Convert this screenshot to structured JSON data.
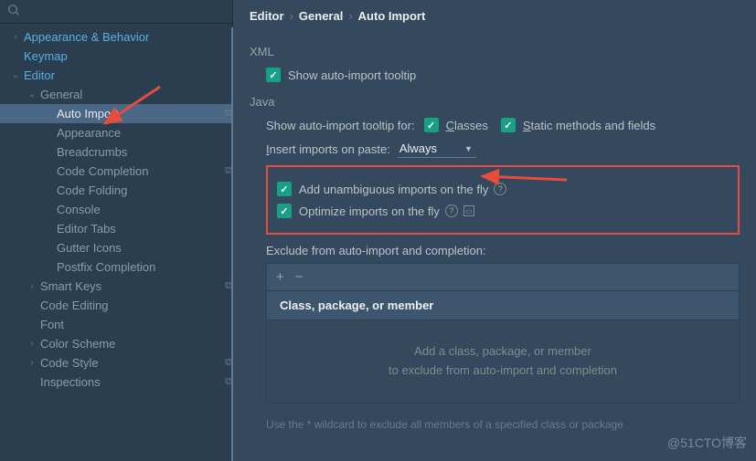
{
  "breadcrumb": {
    "a": "Editor",
    "b": "General",
    "c": "Auto Import"
  },
  "sidebar": {
    "search_placeholder": "",
    "items": [
      {
        "label": "Appearance & Behavior",
        "chev": "›",
        "hl": true
      },
      {
        "label": "Keymap",
        "chev": "",
        "hl": true
      },
      {
        "label": "Editor",
        "chev": "⌄",
        "hl": true
      },
      {
        "label": "General",
        "chev": "⌄",
        "indent": 1
      },
      {
        "label": "Auto Import",
        "chev": "",
        "indent": 2,
        "selected": true,
        "icon": "⧉"
      },
      {
        "label": "Appearance",
        "chev": "",
        "indent": 2
      },
      {
        "label": "Breadcrumbs",
        "chev": "",
        "indent": 2
      },
      {
        "label": "Code Completion",
        "chev": "",
        "indent": 2,
        "icon": "⧉"
      },
      {
        "label": "Code Folding",
        "chev": "",
        "indent": 2
      },
      {
        "label": "Console",
        "chev": "",
        "indent": 2
      },
      {
        "label": "Editor Tabs",
        "chev": "",
        "indent": 2
      },
      {
        "label": "Gutter Icons",
        "chev": "",
        "indent": 2
      },
      {
        "label": "Postfix Completion",
        "chev": "",
        "indent": 2
      },
      {
        "label": "Smart Keys",
        "chev": "›",
        "indent": 1,
        "icon": "⧉"
      },
      {
        "label": "Code Editing",
        "chev": "",
        "indent": 1
      },
      {
        "label": "Font",
        "chev": "",
        "indent": 1
      },
      {
        "label": "Color Scheme",
        "chev": "›",
        "indent": 1
      },
      {
        "label": "Code Style",
        "chev": "›",
        "indent": 1,
        "icon": "⧉"
      },
      {
        "label": "Inspections",
        "chev": "",
        "indent": 1,
        "icon": "⧉"
      }
    ]
  },
  "xml": {
    "title": "XML",
    "show_tooltip": "Show auto-import tooltip"
  },
  "java": {
    "title": "Java",
    "tooltip_for": "Show auto-import tooltip for:",
    "classes": "Classes",
    "static": "Static methods and fields",
    "insert_label": "Insert imports on paste:",
    "insert_value": "Always",
    "add_unambiguous": "Add unambiguous imports on the fly",
    "optimize": "Optimize imports on the fly",
    "exclude_label": "Exclude from auto-import and completion:",
    "table_header": "Class, package, or member",
    "empty1": "Add a class, package, or member",
    "empty2": "to exclude from auto-import and completion",
    "hint": "Use the * wildcard to exclude all members of a specified class or package"
  },
  "watermark": "@51CTO博客"
}
